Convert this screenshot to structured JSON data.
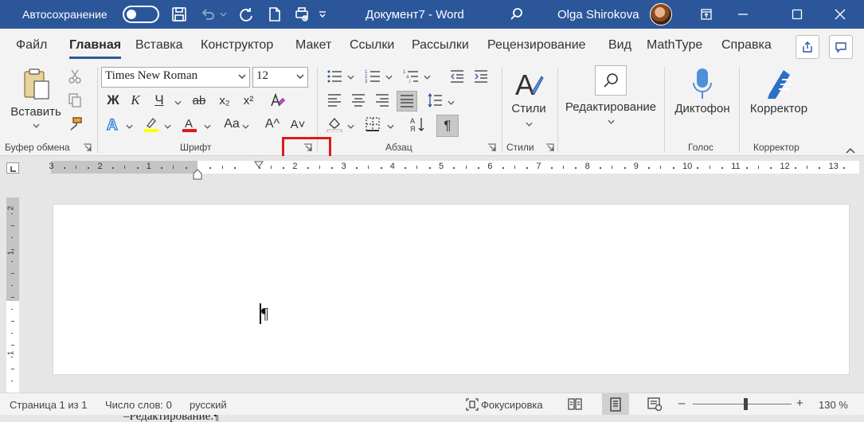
{
  "titlebar": {
    "autosave_label": "Автосохранение",
    "autosave_state": "off",
    "doc_title": "Документ7  -  Word",
    "user_name": "Olga Shirokova"
  },
  "tabs": [
    {
      "label": "Файл",
      "active": false
    },
    {
      "label": "Главная",
      "active": true
    },
    {
      "label": "Вставка",
      "active": false
    },
    {
      "label": "Конструктор",
      "active": false
    },
    {
      "label": "Макет",
      "active": false
    },
    {
      "label": "Ссылки",
      "active": false
    },
    {
      "label": "Рассылки",
      "active": false
    },
    {
      "label": "Рецензирование",
      "active": false
    },
    {
      "label": "Вид",
      "active": false
    },
    {
      "label": "MathType",
      "active": false
    },
    {
      "label": "Справка",
      "active": false
    }
  ],
  "ribbon": {
    "clipboard": {
      "paste_label": "Вставить",
      "group_label": "Буфер обмена"
    },
    "font": {
      "font_name": "Times New Roman",
      "font_size": "12",
      "bold": "Ж",
      "italic": "К",
      "underline": "Ч",
      "strike": "ab",
      "subscript": "x₂",
      "superscript": "x²",
      "change_case": "Aa",
      "grow": "A^",
      "shrink": "A˅",
      "group_label": "Шрифт"
    },
    "paragraph": {
      "group_label": "Абзац",
      "show_marks": "¶"
    },
    "styles": {
      "label": "Стили",
      "group_label": "Стили"
    },
    "editing": {
      "label": "Редактирование"
    },
    "voice": {
      "label": "Диктофон",
      "group_label": "Голос"
    },
    "corrector": {
      "label": "Корректор",
      "group_label": "Корректор"
    }
  },
  "ruler": {
    "numbers_left": [
      "3",
      "2",
      "1"
    ],
    "numbers_right": [
      "2",
      "3",
      "4",
      "5",
      "6",
      "7",
      "8",
      "9",
      "10",
      "11",
      "12",
      "13"
    ]
  },
  "vruler": {
    "numbers": [
      "2",
      "1",
      "1"
    ]
  },
  "document": {
    "paragraph_mark": "¶"
  },
  "statusbar": {
    "page": "Страница 1 из 1",
    "words": "Число слов: 0",
    "language": "русский",
    "focus": "Фокусировка",
    "zoom": "130 %",
    "zoom_minus": "–",
    "zoom_plus": "+"
  },
  "bottom_text": "–Редактирование.¶",
  "colors": {
    "accent": "#2b579a",
    "highlight_box": "#e0191b",
    "font_color": "#e0191b",
    "highlight_color": "#ffff00"
  }
}
